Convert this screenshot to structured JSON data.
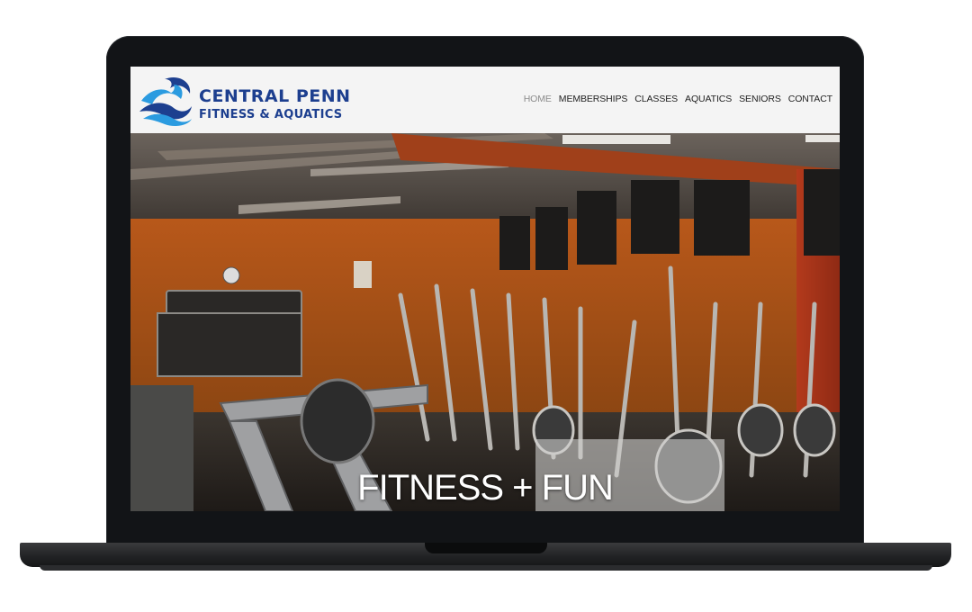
{
  "site": {
    "logo": {
      "line1": "CENTRAL PENN",
      "line2": "FITNESS & AQUATICS"
    },
    "nav": [
      {
        "label": "HOME",
        "active": true
      },
      {
        "label": "MEMBERSHIPS",
        "active": false
      },
      {
        "label": "CLASSES",
        "active": false
      },
      {
        "label": "AQUATICS",
        "active": false
      },
      {
        "label": "SENIORS",
        "active": false
      },
      {
        "label": "CONTACT",
        "active": false
      }
    ],
    "hero": {
      "title": "FITNESS + FUN",
      "image": "gym-cardio-equipment-photo"
    }
  },
  "colors": {
    "brand_blue": "#1d3f8f",
    "logo_light_blue": "#2b9be0",
    "header_bg": "#f4f4f4",
    "wall_orange": "#c8641c",
    "laptop_body": "#121417"
  }
}
